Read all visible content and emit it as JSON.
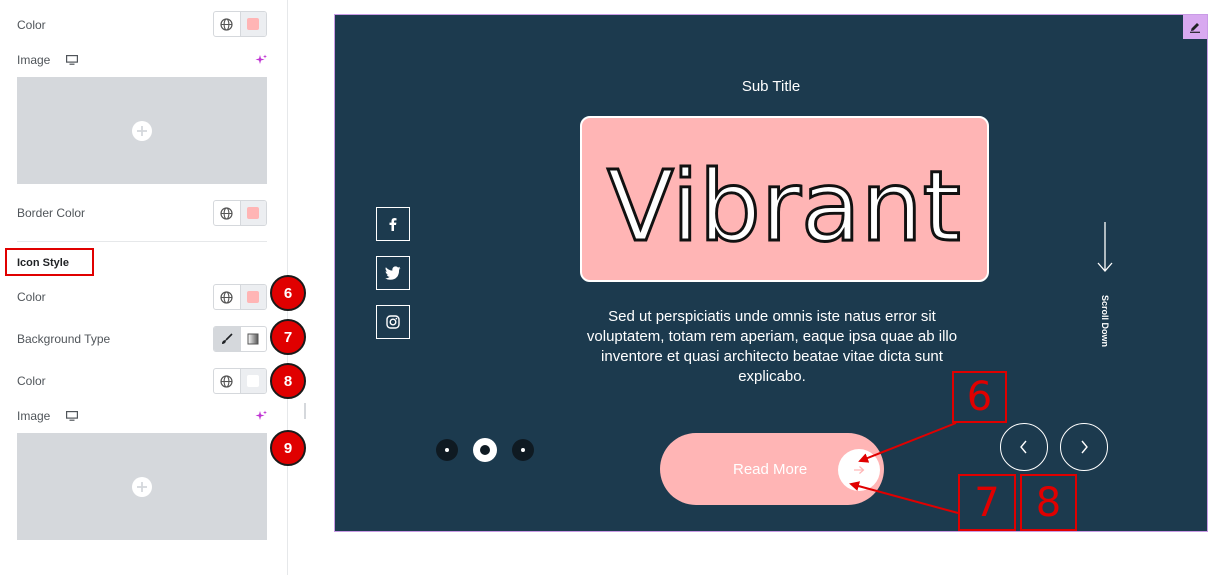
{
  "panel": {
    "rows": {
      "color_top": "Color",
      "image_top": "Image",
      "border_color": "Border Color",
      "icon_color": "Color",
      "background_type": "Background Type",
      "bg_color": "Color",
      "image_bottom": "Image"
    },
    "section_title": "Icon Style",
    "markers": [
      "6",
      "7",
      "8",
      "9"
    ],
    "colors": {
      "swatch_pink": "#ffb5b5",
      "swatch_white": "#ffffff"
    }
  },
  "preview": {
    "subtitle": "Sub Title",
    "title": "Vibrant",
    "description": "Sed ut perspiciatis unde omnis iste natus error sit voluptatem, totam rem aperiam, eaque ipsa quae ab illo inventore et quasi architecto beatae vitae dicta sunt explicabo.",
    "button_label": "Read More",
    "scroll_label": "Scroll Down",
    "social_icons": [
      "facebook-icon",
      "twitter-icon",
      "instagram-icon"
    ],
    "pagination_active": 1,
    "colors": {
      "background": "#1c3a4e",
      "accent": "#ffb5b5",
      "annotation": "#e00000"
    }
  },
  "annotations": {
    "box_6": "6",
    "box_7": "7",
    "box_8": "8"
  }
}
